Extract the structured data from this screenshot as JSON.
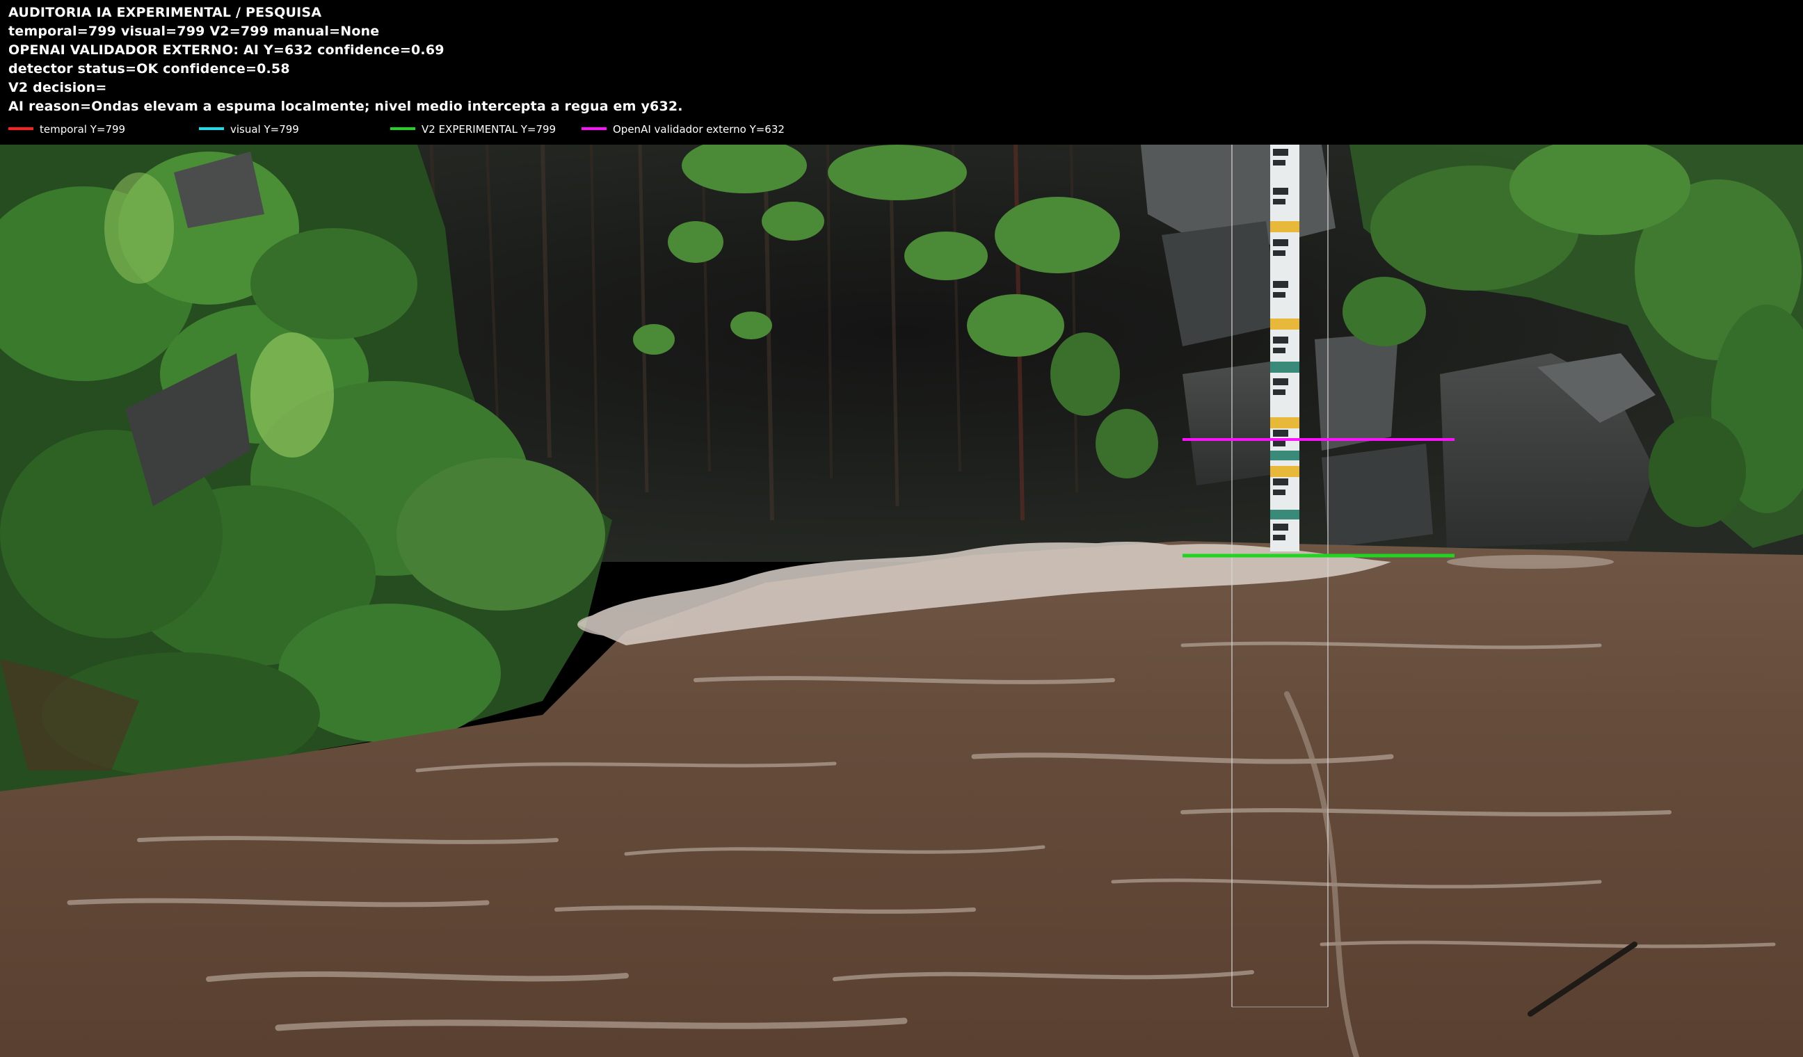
{
  "header": {
    "line1": "AUDITORIA IA  EXPERIMENTAL / PESQUISA",
    "line2": "temporal=799  visual=799  V2=799  manual=None",
    "line3": "OPENAI  VALIDADOR EXTERNO: AI Y=632  confidence=0.69",
    "line4": "detector status=OK confidence=0.58",
    "line5": "V2 decision=",
    "line6": "AI reason=Ondas elevam a espuma localmente; nivel medio intercepta a regua em y632."
  },
  "legend": [
    {
      "label": "temporal Y=799",
      "color": "#ff2020"
    },
    {
      "label": "visual Y=799",
      "color": "#16e0f0"
    },
    {
      "label": "V2 EXPERIMENTAL Y=799",
      "color": "#22d422"
    },
    {
      "label": "OpenAI validador externo Y=632",
      "color": "#ff10ff"
    }
  ],
  "markers": {
    "openai_line_color": "#ff10ff",
    "v2_line_color": "#22d422",
    "roi_color": "#d8d8d8"
  },
  "icons": {
    "gauge": "staff-gauge-ruler-icon"
  }
}
